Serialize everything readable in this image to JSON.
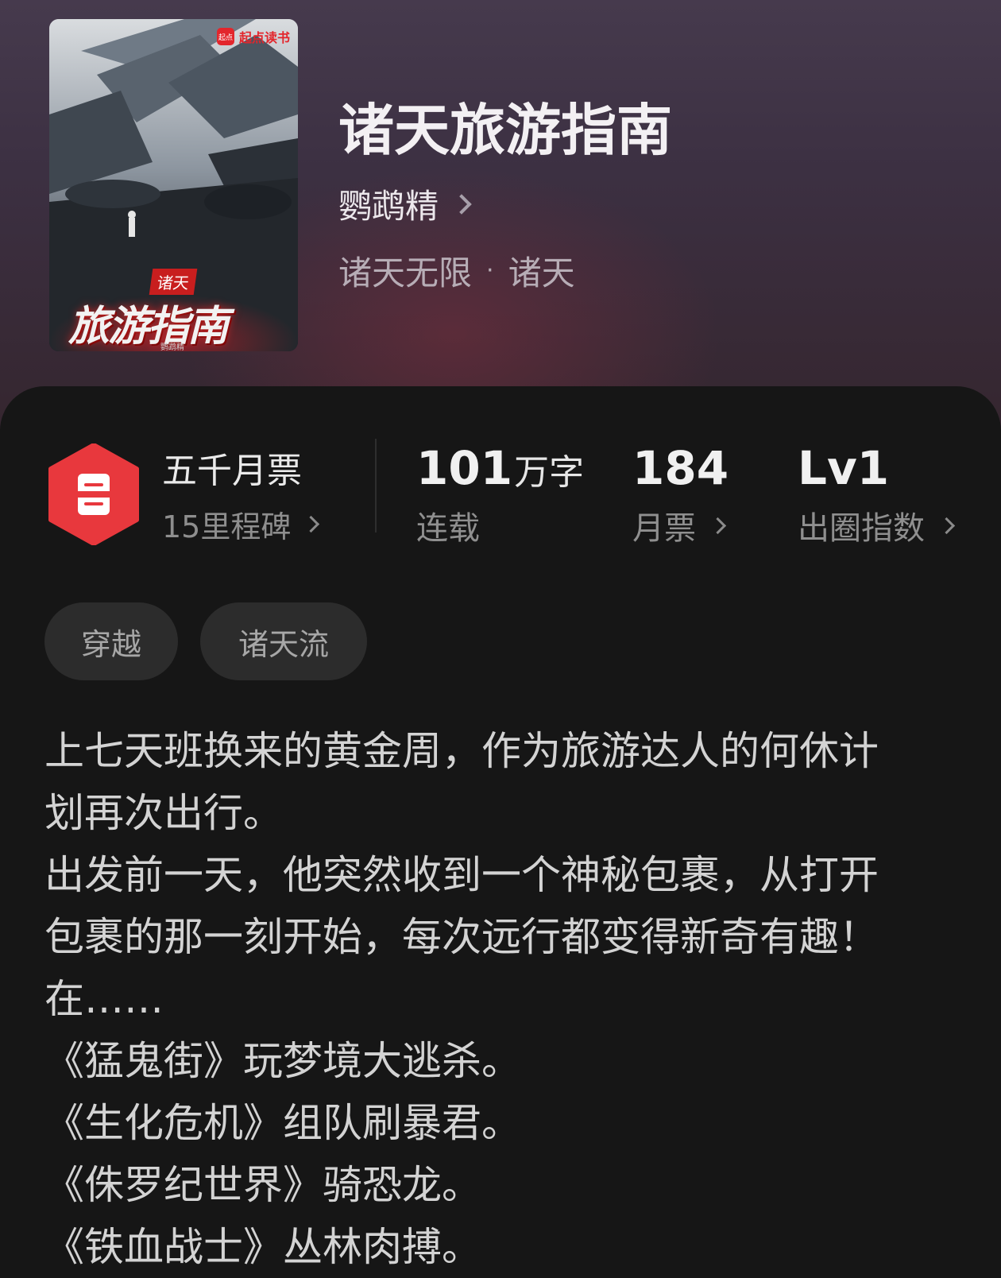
{
  "book": {
    "cover_badge": "起点读书",
    "cover_badge_mark": "起点",
    "cover_tag": "诸天",
    "cover_title": "旅游指南",
    "cover_author": "鹦鹉精",
    "title": "诸天旅游指南",
    "author": "鹦鹉精",
    "genre": "诸天无限",
    "subgenre": "诸天",
    "genre_separator": "·"
  },
  "stats": {
    "ticket_title": "五千月票",
    "ticket_sub": "15里程碑",
    "words_value": "101",
    "words_unit": "万字",
    "words_label": "连载",
    "monthly_value": "184",
    "monthly_label": "月票",
    "index_value": "Lv1",
    "index_label": "出圈指数"
  },
  "tags": [
    "穿越",
    "诸天流"
  ],
  "description": [
    "上七天班换来的黄金周，作为旅游达人的何休计",
    "划再次出行。",
    "出发前一天，他突然收到一个神秘包裹，从打开",
    "包裹的那一刻开始，每次远行都变得新奇有趣！",
    "在……",
    "《猛鬼街》玩梦境大逃杀。",
    "《生化危机》组队刷暴君。",
    "《侏罗纪世界》骑恐龙。",
    "《铁血战士》丛林肉搏。"
  ],
  "colors": {
    "accent": "#e8383d",
    "background": "#161616",
    "hero_top": "#463a4d"
  }
}
